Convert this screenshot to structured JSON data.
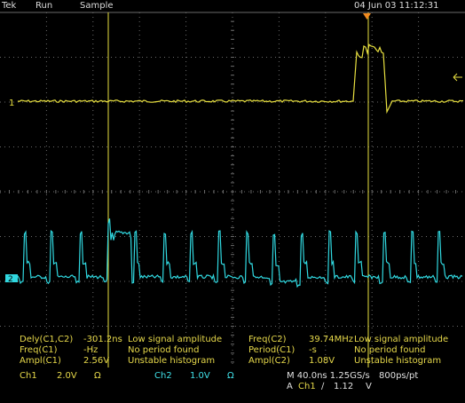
{
  "header": {
    "brand": "Tek",
    "run_state": "Run",
    "acq_mode": "Sample",
    "datetime": "04 Jun 03 11:12:31"
  },
  "markers": {
    "ch1_level": "1",
    "ch2_level": "2"
  },
  "colors": {
    "ch1": "#e8e040",
    "ch2": "#30d8e0",
    "grid": "#6a6a6a",
    "trigger": "#f08a20"
  },
  "measurements": {
    "left": [
      {
        "name": "Dely(C1,C2)",
        "value": "-301.2ns",
        "note": "Low signal amplitude"
      },
      {
        "name": "Freq(C1)",
        "value": "-Hz",
        "note": "No period found"
      },
      {
        "name": "Ampl(C1)",
        "value": "2.56V",
        "note": "Unstable histogram"
      }
    ],
    "right": [
      {
        "name": "Freq(C2)",
        "value": "39.74MHz",
        "note": "Low signal amplitude"
      },
      {
        "name": "Period(C1)",
        "value": "-s",
        "note": "No period found"
      },
      {
        "name": "Ampl(C2)",
        "value": "1.08V",
        "note": "Unstable histogram"
      }
    ]
  },
  "status": {
    "ch1_label": "Ch1",
    "ch1_scale": "2.0V",
    "ch1_coupling": "Ω",
    "ch2_label": "Ch2",
    "ch2_scale": "1.0V",
    "ch2_coupling": "Ω",
    "timebase": "M 40.0ns 1.25GS/s",
    "resolution": "800ps/pt",
    "trigger_prefix": "A",
    "trigger_source": "Ch1",
    "trigger_slope": "∕",
    "trigger_level": "1.12",
    "trigger_unit": "V"
  }
}
